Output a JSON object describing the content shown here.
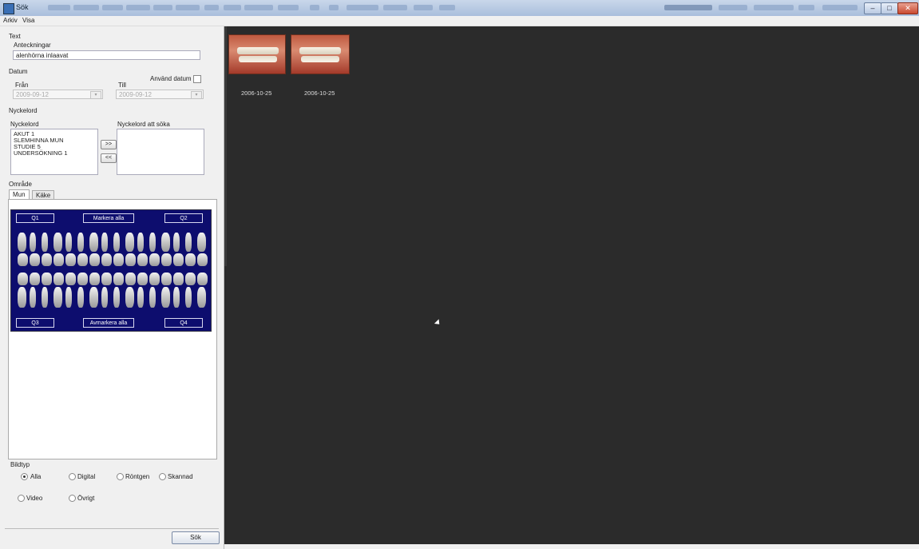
{
  "window": {
    "title": "Sök"
  },
  "menu": [
    "Arkiv",
    "Visa"
  ],
  "left": {
    "text_section": "Text",
    "notes_label": "Anteckningar",
    "notes_value": "alenhörna inlaavat",
    "date_section": "Datum",
    "from_label": "Från",
    "to_label": "Till",
    "use_date_label": "Använd datum",
    "from_value": "2009-09-12",
    "to_value": "2009-09-12",
    "keywords_section": "Nyckelord",
    "keywords_label": "Nyckelord",
    "keywords_search_label": "Nyckelord att söka",
    "keywords": [
      "AKUT 1",
      "SLEMHINNA MUN",
      "STUDIE 5",
      "UNDERSÖKNING 1"
    ],
    "add_btn": ">>",
    "remove_btn": "<<",
    "area_section": "Område",
    "tabs": [
      "Mun",
      "Käke"
    ],
    "q1": "Q1",
    "q2": "Q2",
    "q3": "Q3",
    "q4": "Q4",
    "mark_all": "Markera alla",
    "unmark_all": "Avmarkera alla",
    "image_type_label": "Bildtyp",
    "radios": {
      "all": "Alla",
      "digital": "Digital",
      "xray": "Röntgen",
      "scanned": "Skannad",
      "video": "Video",
      "other": "Övrigt"
    },
    "search_button": "Sök"
  },
  "thumbnails": [
    {
      "date": "2006-10-25"
    },
    {
      "date": "2006-10-25"
    }
  ],
  "colors": {
    "chart_bg": "#0d0d6e",
    "viewer_bg": "#2b2b2b"
  }
}
